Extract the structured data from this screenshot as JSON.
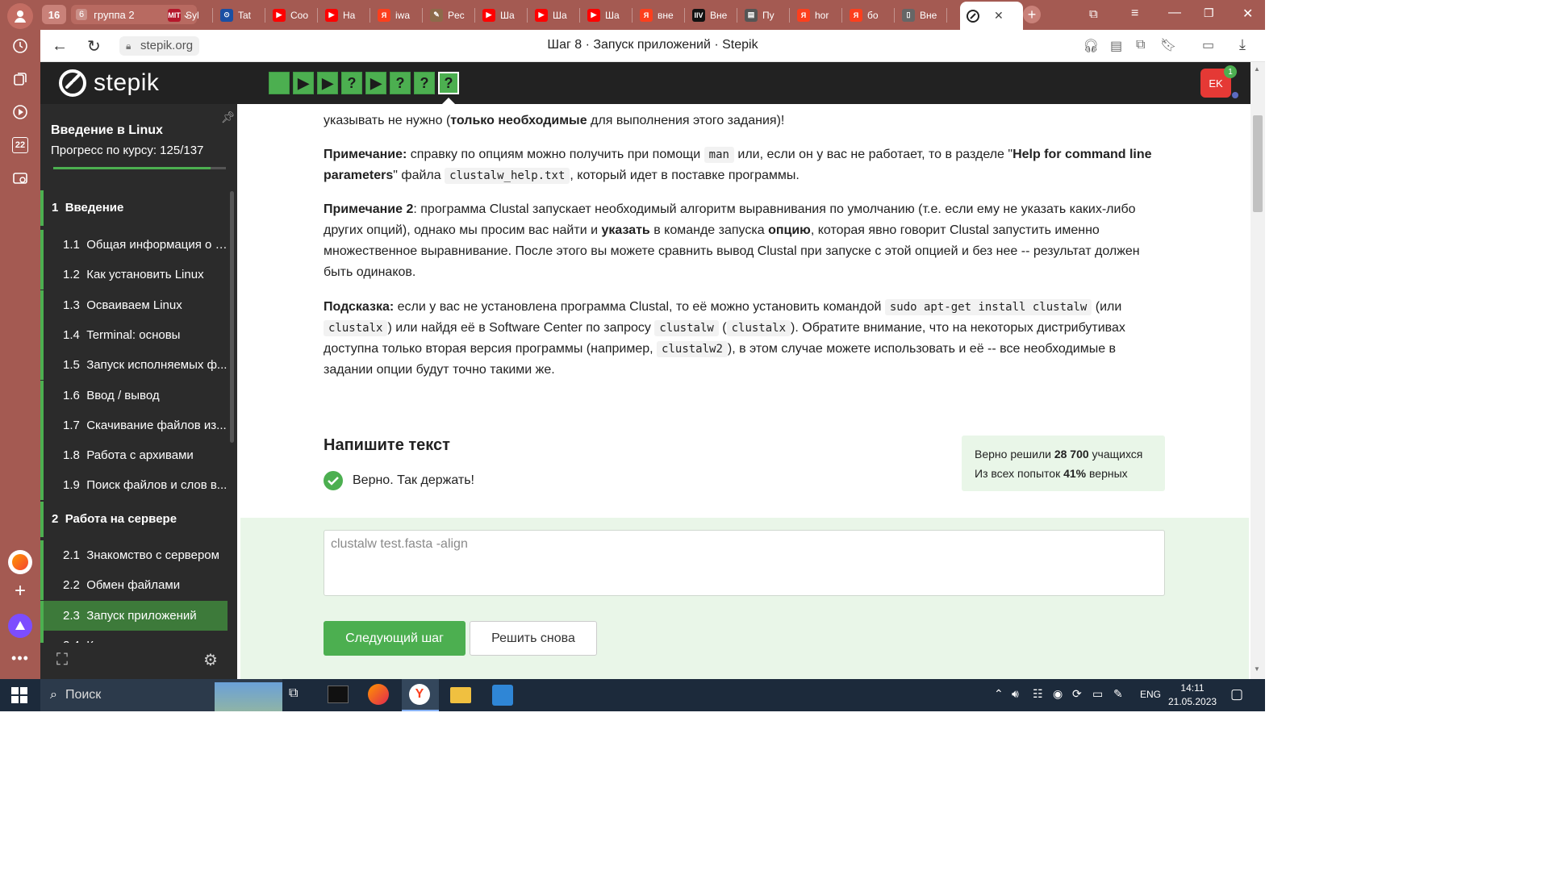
{
  "browser": {
    "tab_group_count": "16",
    "tab_group_badge": "6",
    "tab_group_label": "группа 2",
    "tabs": [
      {
        "label": "Syl",
        "icon": "mitocw-icon",
        "color": "#b5162b",
        "glyph": "MIT"
      },
      {
        "label": "Tat",
        "icon": "blue-circle-icon",
        "color": "#1a4fa3",
        "glyph": "⊙"
      },
      {
        "label": "Coo",
        "icon": "youtube-icon",
        "color": "#ff0000",
        "glyph": "▶"
      },
      {
        "label": "Ha",
        "icon": "youtube-icon",
        "color": "#ff0000",
        "glyph": "▶"
      },
      {
        "label": "iwa",
        "icon": "yandex-icon",
        "color": "#fc3f1d",
        "glyph": "Я"
      },
      {
        "label": "Pec",
        "icon": "tool-icon",
        "color": "#8c6b4b",
        "glyph": "✎"
      },
      {
        "label": "Ша",
        "icon": "youtube-icon",
        "color": "#ff0000",
        "glyph": "▶"
      },
      {
        "label": "Ша",
        "icon": "youtube-icon",
        "color": "#ff0000",
        "glyph": "▶"
      },
      {
        "label": "Ша",
        "icon": "youtube-icon",
        "color": "#ff0000",
        "glyph": "▶"
      },
      {
        "label": "вне",
        "icon": "yandex-icon",
        "color": "#fc3f1d",
        "glyph": "Я"
      },
      {
        "label": "Вне",
        "icon": "ivi-icon",
        "color": "#111111",
        "glyph": "IIV"
      },
      {
        "label": "Пу",
        "icon": "doc-icon",
        "color": "#555555",
        "glyph": "▤"
      },
      {
        "label": "hor",
        "icon": "yandex-icon",
        "color": "#fc3f1d",
        "glyph": "Я"
      },
      {
        "label": "бо",
        "icon": "yandex-icon",
        "color": "#fc3f1d",
        "glyph": "Я"
      },
      {
        "label": "Вне",
        "icon": "page-icon",
        "color": "#666666",
        "glyph": "▯"
      }
    ],
    "url": "stepik.org",
    "page_title": "Шаг 8 · Запуск приложений · Stepik"
  },
  "rail": {
    "badge_22": "22"
  },
  "header": {
    "logo_text": "stepik",
    "steps": [
      "done",
      "play",
      "play",
      "question",
      "play",
      "question",
      "question",
      "question"
    ],
    "avatar_initials": "EK",
    "notification_count": "1"
  },
  "sidebar": {
    "course_title": "Введение в Linux",
    "progress_label": "Прогресс по курсу:",
    "progress_value": "125/137",
    "progress_fraction": 0.912,
    "modules": [
      {
        "num": "1",
        "title": "Введение"
      },
      {
        "num": "2",
        "title": "Работа на сервере"
      }
    ],
    "lessons_m1": [
      {
        "num": "1.1",
        "title": "Общая информация о к..."
      },
      {
        "num": "1.2",
        "title": "Как установить Linux"
      },
      {
        "num": "1.3",
        "title": "Осваиваем Linux"
      },
      {
        "num": "1.4",
        "title": "Terminal: основы"
      },
      {
        "num": "1.5",
        "title": "Запуск исполняемых ф..."
      },
      {
        "num": "1.6",
        "title": "Ввод / вывод"
      },
      {
        "num": "1.7",
        "title": "Скачивание файлов из..."
      },
      {
        "num": "1.8",
        "title": "Работа с архивами"
      },
      {
        "num": "1.9",
        "title": "Поиск файлов и слов в..."
      }
    ],
    "lessons_m2": [
      {
        "num": "2.1",
        "title": "Знакомство с сервером"
      },
      {
        "num": "2.2",
        "title": "Обмен файлами"
      },
      {
        "num": "2.3",
        "title": "Запуск приложений"
      },
      {
        "num": "2.4",
        "title": "Контроль запускаемых..."
      }
    ]
  },
  "content": {
    "p0_a": "указывать не нужно (",
    "p0_b": "только необходимые",
    "p0_c": " для выполнения этого задания)!",
    "note1_label": "Примечание:",
    "note1_a": " справку по опциям можно получить при помощи ",
    "note1_code": "man",
    "note1_b": " или, если он у вас не работает, то в разделе \"",
    "note1_bold": "Help for command line parameters",
    "note1_c": "\" файла ",
    "note1_code2": "clustalw_help.txt",
    "note1_d": ", который идет в поставке программы.",
    "note2_label": "Примечание 2",
    "note2_a": ": программа Clustal запускает необходимый алгоритм выравнивания по умолчанию (т.е. если ему не указать каких-либо других опций), однако мы просим вас найти и ",
    "note2_bold1": "указать",
    "note2_b": " в команде запуска ",
    "note2_bold2": "опцию",
    "note2_c": ", которая явно говорит Clustal запустить именно множественное выравнивание. После этого вы можете сравнить вывод Clustal при запуске с этой опцией и без нее -- результат должен быть одинаков.",
    "hint_label": "Подсказка:",
    "hint_a": " если у вас не установлена программа Clustal, то её можно установить командой ",
    "hint_code1": "sudo apt-get install clustalw",
    "hint_b": " (или ",
    "hint_code2": "clustalx",
    "hint_c": ") или найдя её в Software Center по запросу ",
    "hint_code3": "clustalw",
    "hint_d": " (",
    "hint_code4": "clustalx",
    "hint_e": "). Обратите внимание, что на некоторых дистрибутивах доступна только вторая версия программы (например, ",
    "hint_code5": "clustalw2",
    "hint_f": "), в этом случае можете использовать и её -- все необходимые в задании опции будут точно такими же.",
    "task_heading": "Напишите текст",
    "correct_message": "Верно. Так держать!",
    "stats_line1_a": "Верно решили ",
    "stats_line1_num": "28 700",
    "stats_line1_b": " учащихся",
    "stats_line2_a": "Из всех попыток ",
    "stats_line2_num": "41%",
    "stats_line2_b": " верных",
    "answer_text": "clustalw test.fasta -align",
    "next_button": "Следующий шаг",
    "retry_button": "Решить снова"
  },
  "taskbar": {
    "search_label": "Поиск",
    "lang": "ENG",
    "time": "14:11",
    "date": "21.05.2023"
  },
  "colors": {
    "browser_chrome": "#a45a52",
    "stepik_green": "#4caf50",
    "header_dark": "#222222",
    "sidebar_dark": "#2b2b2b",
    "selected_lesson": "#3d7a3a",
    "answer_bg": "#e9f6e8",
    "stats_bg": "#e9f6e8",
    "avatar": "#e53935",
    "taskbar": "#1c2a3b"
  }
}
